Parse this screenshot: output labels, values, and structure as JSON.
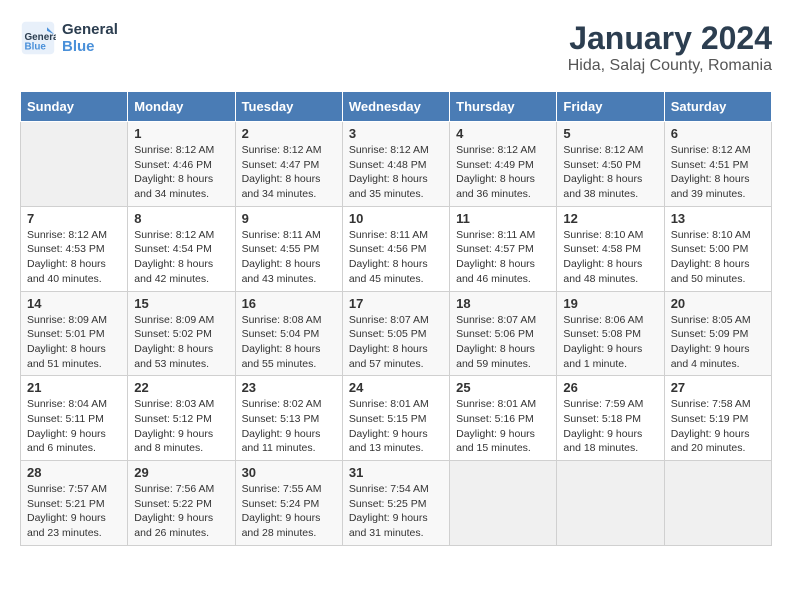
{
  "header": {
    "logo_line1": "General",
    "logo_line2": "Blue",
    "title": "January 2024",
    "subtitle": "Hida, Salaj County, Romania"
  },
  "days_of_week": [
    "Sunday",
    "Monday",
    "Tuesday",
    "Wednesday",
    "Thursday",
    "Friday",
    "Saturday"
  ],
  "weeks": [
    [
      {
        "day": "",
        "info": ""
      },
      {
        "day": "1",
        "info": "Sunrise: 8:12 AM\nSunset: 4:46 PM\nDaylight: 8 hours\nand 34 minutes."
      },
      {
        "day": "2",
        "info": "Sunrise: 8:12 AM\nSunset: 4:47 PM\nDaylight: 8 hours\nand 34 minutes."
      },
      {
        "day": "3",
        "info": "Sunrise: 8:12 AM\nSunset: 4:48 PM\nDaylight: 8 hours\nand 35 minutes."
      },
      {
        "day": "4",
        "info": "Sunrise: 8:12 AM\nSunset: 4:49 PM\nDaylight: 8 hours\nand 36 minutes."
      },
      {
        "day": "5",
        "info": "Sunrise: 8:12 AM\nSunset: 4:50 PM\nDaylight: 8 hours\nand 38 minutes."
      },
      {
        "day": "6",
        "info": "Sunrise: 8:12 AM\nSunset: 4:51 PM\nDaylight: 8 hours\nand 39 minutes."
      }
    ],
    [
      {
        "day": "7",
        "info": "Sunrise: 8:12 AM\nSunset: 4:53 PM\nDaylight: 8 hours\nand 40 minutes."
      },
      {
        "day": "8",
        "info": "Sunrise: 8:12 AM\nSunset: 4:54 PM\nDaylight: 8 hours\nand 42 minutes."
      },
      {
        "day": "9",
        "info": "Sunrise: 8:11 AM\nSunset: 4:55 PM\nDaylight: 8 hours\nand 43 minutes."
      },
      {
        "day": "10",
        "info": "Sunrise: 8:11 AM\nSunset: 4:56 PM\nDaylight: 8 hours\nand 45 minutes."
      },
      {
        "day": "11",
        "info": "Sunrise: 8:11 AM\nSunset: 4:57 PM\nDaylight: 8 hours\nand 46 minutes."
      },
      {
        "day": "12",
        "info": "Sunrise: 8:10 AM\nSunset: 4:58 PM\nDaylight: 8 hours\nand 48 minutes."
      },
      {
        "day": "13",
        "info": "Sunrise: 8:10 AM\nSunset: 5:00 PM\nDaylight: 8 hours\nand 50 minutes."
      }
    ],
    [
      {
        "day": "14",
        "info": "Sunrise: 8:09 AM\nSunset: 5:01 PM\nDaylight: 8 hours\nand 51 minutes."
      },
      {
        "day": "15",
        "info": "Sunrise: 8:09 AM\nSunset: 5:02 PM\nDaylight: 8 hours\nand 53 minutes."
      },
      {
        "day": "16",
        "info": "Sunrise: 8:08 AM\nSunset: 5:04 PM\nDaylight: 8 hours\nand 55 minutes."
      },
      {
        "day": "17",
        "info": "Sunrise: 8:07 AM\nSunset: 5:05 PM\nDaylight: 8 hours\nand 57 minutes."
      },
      {
        "day": "18",
        "info": "Sunrise: 8:07 AM\nSunset: 5:06 PM\nDaylight: 8 hours\nand 59 minutes."
      },
      {
        "day": "19",
        "info": "Sunrise: 8:06 AM\nSunset: 5:08 PM\nDaylight: 9 hours\nand 1 minute."
      },
      {
        "day": "20",
        "info": "Sunrise: 8:05 AM\nSunset: 5:09 PM\nDaylight: 9 hours\nand 4 minutes."
      }
    ],
    [
      {
        "day": "21",
        "info": "Sunrise: 8:04 AM\nSunset: 5:11 PM\nDaylight: 9 hours\nand 6 minutes."
      },
      {
        "day": "22",
        "info": "Sunrise: 8:03 AM\nSunset: 5:12 PM\nDaylight: 9 hours\nand 8 minutes."
      },
      {
        "day": "23",
        "info": "Sunrise: 8:02 AM\nSunset: 5:13 PM\nDaylight: 9 hours\nand 11 minutes."
      },
      {
        "day": "24",
        "info": "Sunrise: 8:01 AM\nSunset: 5:15 PM\nDaylight: 9 hours\nand 13 minutes."
      },
      {
        "day": "25",
        "info": "Sunrise: 8:01 AM\nSunset: 5:16 PM\nDaylight: 9 hours\nand 15 minutes."
      },
      {
        "day": "26",
        "info": "Sunrise: 7:59 AM\nSunset: 5:18 PM\nDaylight: 9 hours\nand 18 minutes."
      },
      {
        "day": "27",
        "info": "Sunrise: 7:58 AM\nSunset: 5:19 PM\nDaylight: 9 hours\nand 20 minutes."
      }
    ],
    [
      {
        "day": "28",
        "info": "Sunrise: 7:57 AM\nSunset: 5:21 PM\nDaylight: 9 hours\nand 23 minutes."
      },
      {
        "day": "29",
        "info": "Sunrise: 7:56 AM\nSunset: 5:22 PM\nDaylight: 9 hours\nand 26 minutes."
      },
      {
        "day": "30",
        "info": "Sunrise: 7:55 AM\nSunset: 5:24 PM\nDaylight: 9 hours\nand 28 minutes."
      },
      {
        "day": "31",
        "info": "Sunrise: 7:54 AM\nSunset: 5:25 PM\nDaylight: 9 hours\nand 31 minutes."
      },
      {
        "day": "",
        "info": ""
      },
      {
        "day": "",
        "info": ""
      },
      {
        "day": "",
        "info": ""
      }
    ]
  ]
}
